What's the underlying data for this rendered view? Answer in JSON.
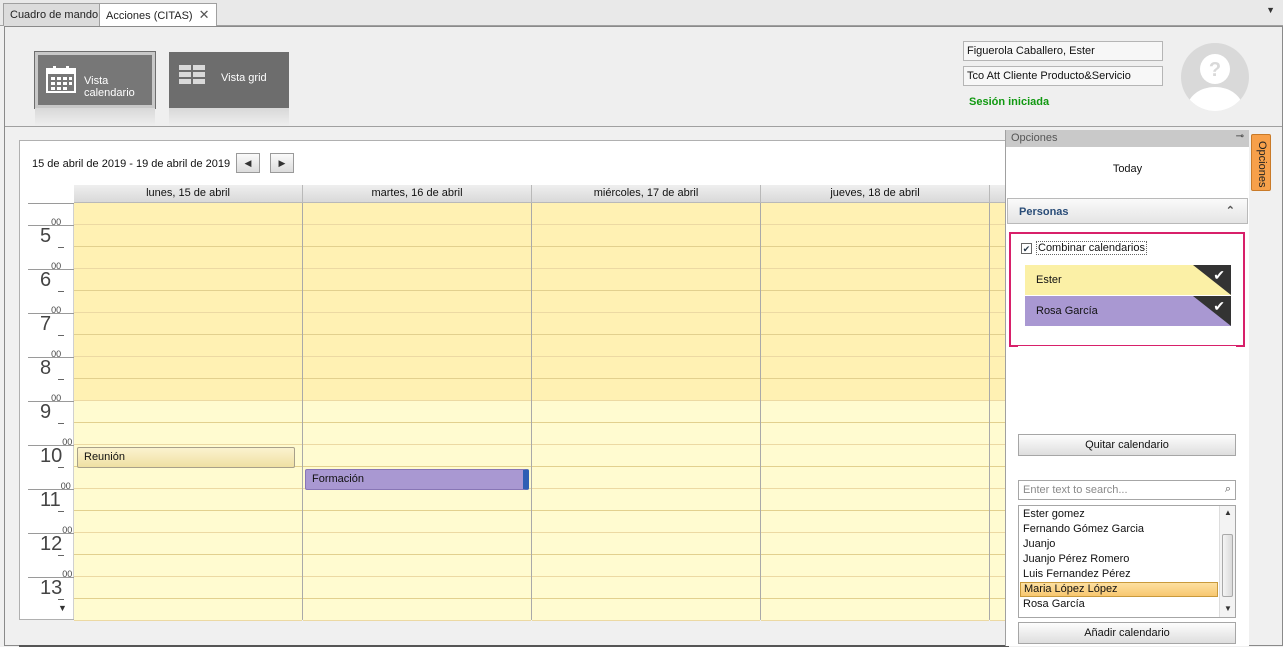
{
  "tabs": [
    {
      "label": "Cuadro de mando"
    },
    {
      "label": "Acciones (CITAS)"
    }
  ],
  "toolbar": {
    "calendar_view_label": "Vista calendario",
    "grid_view_label": "Vista grid"
  },
  "user": {
    "name": "Figuerola Caballero, Ester",
    "role": "Tco Att Cliente Producto&Servicio",
    "session_status": "Sesión iniciada"
  },
  "calendar": {
    "date_range": "15 de abril de 2019 - 19 de abril de 2019",
    "days": [
      "lunes, 15 de abril",
      "martes, 16 de abril",
      "miércoles, 17 de abril",
      "jueves, 18 de abril"
    ],
    "hours": [
      {
        "h": "5",
        "m": "00"
      },
      {
        "h": "6",
        "m": "00"
      },
      {
        "h": "7",
        "m": "00"
      },
      {
        "h": "8",
        "m": "00"
      },
      {
        "h": "9",
        "m": "00"
      },
      {
        "h": "10",
        "m": "00"
      },
      {
        "h": "11",
        "m": "00"
      },
      {
        "h": "12",
        "m": "00"
      },
      {
        "h": "13",
        "m": "00"
      }
    ],
    "appointments": [
      {
        "title": "Reunión",
        "day": "lunes, 15 de abril",
        "color": "#f6eab8"
      },
      {
        "title": "Formación",
        "day": "martes, 16 de abril",
        "color": "#a998d2"
      }
    ],
    "colors": {
      "work_hours": "#fffbd0",
      "off_hours": "#fff1b3"
    }
  },
  "options_panel": {
    "header": "Opciones",
    "today_label": "Today",
    "persons_header": "Personas",
    "combine_label": "Combinar calendarios",
    "combine_checked": true,
    "persons": [
      {
        "name": "Ester",
        "color": "#fbf0a6",
        "checked": true
      },
      {
        "name": "Rosa García",
        "color": "#a998d2",
        "checked": true
      }
    ],
    "remove_button": "Quitar calendario",
    "search_placeholder": "Enter text to search...",
    "list": [
      "Ester gomez",
      "Fernando Gómez Garcia",
      "Juanjo",
      "Juanjo Pérez Romero",
      "Luis Fernandez Pérez",
      "Maria López López",
      "Rosa García"
    ],
    "selected": "Maria López López",
    "add_button": "Añadir calendario",
    "side_tab": "Opciones"
  }
}
